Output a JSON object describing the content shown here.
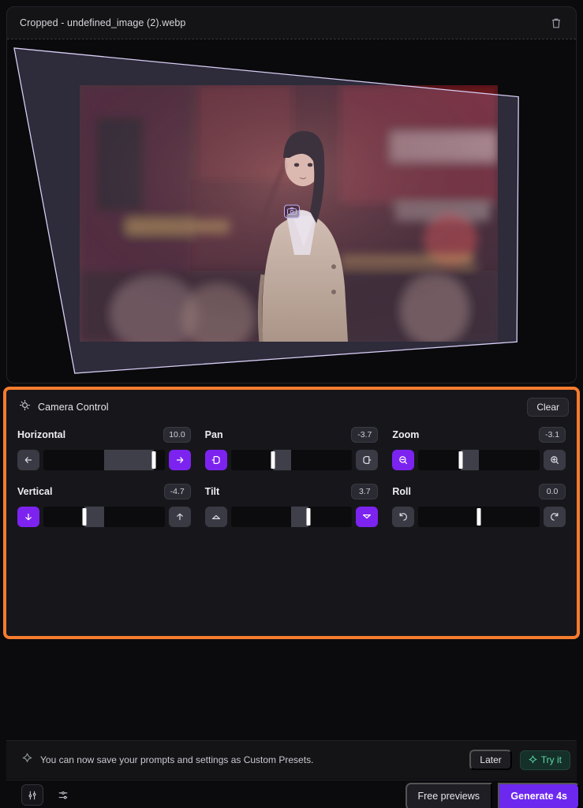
{
  "preview": {
    "file_name": "Cropped - undefined_image (2).webp",
    "delete_icon": "trash-icon",
    "camera_badge_icon": "camera-icon"
  },
  "camera_control": {
    "title": "Camera Control",
    "title_icon": "camera-move-icon",
    "clear_label": "Clear",
    "controls": [
      {
        "label": "Horizontal",
        "value": "10.0",
        "left_icon": "arrow-left-icon",
        "right_icon": "arrow-right-icon",
        "left_active": false,
        "right_active": true,
        "knob_pct": 91,
        "fill_from_pct": 50,
        "fill_to_pct": 91
      },
      {
        "label": "Pan",
        "value": "-3.7",
        "left_icon": "pan-left-icon",
        "right_icon": "pan-right-icon",
        "left_active": true,
        "right_active": false,
        "knob_pct": 35,
        "fill_from_pct": 35,
        "fill_to_pct": 50
      },
      {
        "label": "Zoom",
        "value": "-3.1",
        "left_icon": "zoom-out-icon",
        "right_icon": "zoom-in-icon",
        "left_active": true,
        "right_active": false,
        "knob_pct": 35,
        "fill_from_pct": 35,
        "fill_to_pct": 50
      },
      {
        "label": "Vertical",
        "value": "-4.7",
        "left_icon": "arrow-down-icon",
        "right_icon": "arrow-up-icon",
        "left_active": true,
        "right_active": false,
        "knob_pct": 34,
        "fill_from_pct": 34,
        "fill_to_pct": 50
      },
      {
        "label": "Tilt",
        "value": "3.7",
        "left_icon": "tilt-up-icon",
        "right_icon": "tilt-down-icon",
        "left_active": false,
        "right_active": true,
        "knob_pct": 64,
        "fill_from_pct": 50,
        "fill_to_pct": 64
      },
      {
        "label": "Roll",
        "value": "0.0",
        "left_icon": "rotate-ccw-icon",
        "right_icon": "rotate-cw-icon",
        "left_active": false,
        "right_active": false,
        "knob_pct": 50,
        "fill_from_pct": 50,
        "fill_to_pct": 50
      }
    ]
  },
  "banner": {
    "icon": "sparkle-icon",
    "text": "You can now save your prompts and settings as Custom Presets.",
    "later_label": "Later",
    "tryit_label": "Try it",
    "tryit_icon": "sparkle-icon"
  },
  "toolbar": {
    "settings_icon": "sliders-vertical-icon",
    "filters_icon": "sliders-horizontal-icon",
    "free_previews_label": "Free previews",
    "generate_label": "Generate 4s"
  },
  "colors": {
    "accent_purple": "#7c23f0",
    "highlight_orange": "#f57c2e",
    "teal": "#5ed6a8",
    "panel_bg": "#17171b"
  }
}
